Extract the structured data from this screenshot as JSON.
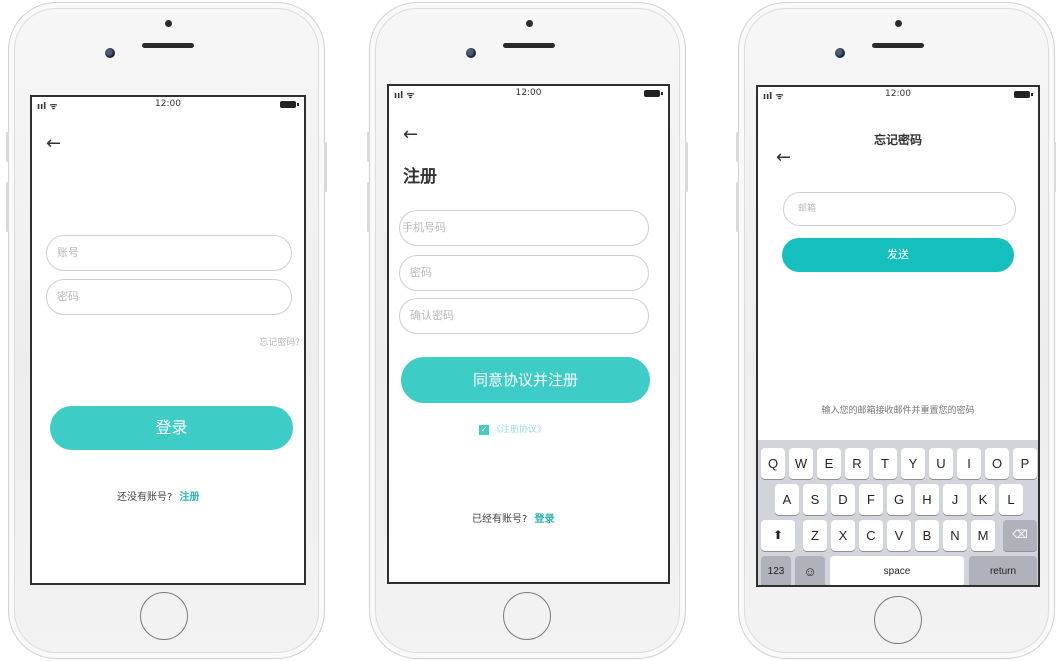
{
  "status": {
    "signal": "ııl ᯤ",
    "time": "12:00"
  },
  "login": {
    "back_icon": "arrow-left-icon",
    "account_placeholder": "账号",
    "password_placeholder": "密码",
    "forgot_link": "忘记密码?",
    "login_button": "登录",
    "no_account_text": "还没有账号?",
    "register_link": "注册"
  },
  "register": {
    "back_icon": "arrow-left-icon",
    "title": "注册",
    "phone_placeholder": "手机号码",
    "password_placeholder": "密码",
    "confirm_placeholder": "确认密码",
    "register_button": "同意协议并注册",
    "agreement_checked": true,
    "agreement_label": "《注册协议》",
    "have_account_text": "已经有账号?",
    "login_link": "登录"
  },
  "forgot": {
    "back_icon": "arrow-left-icon",
    "title": "忘记密码",
    "email_placeholder": "邮箱",
    "send_button": "发送",
    "hint": "输入您的邮箱接收邮件并重置您的密码"
  },
  "keyboard": {
    "row1": [
      "Q",
      "W",
      "E",
      "R",
      "T",
      "Y",
      "U",
      "I",
      "O",
      "P"
    ],
    "row2": [
      "A",
      "S",
      "D",
      "F",
      "G",
      "H",
      "J",
      "K",
      "L"
    ],
    "row3": [
      "Z",
      "X",
      "C",
      "V",
      "B",
      "N",
      "M"
    ],
    "shift_icon": "shift-icon",
    "delete_icon": "delete-icon",
    "num_key": "123",
    "emoji_icon": "emoji-icon",
    "space_key": "space",
    "return_key": "return"
  },
  "colors": {
    "accent": "#3ecdc6",
    "link": "#2ab6b0"
  }
}
